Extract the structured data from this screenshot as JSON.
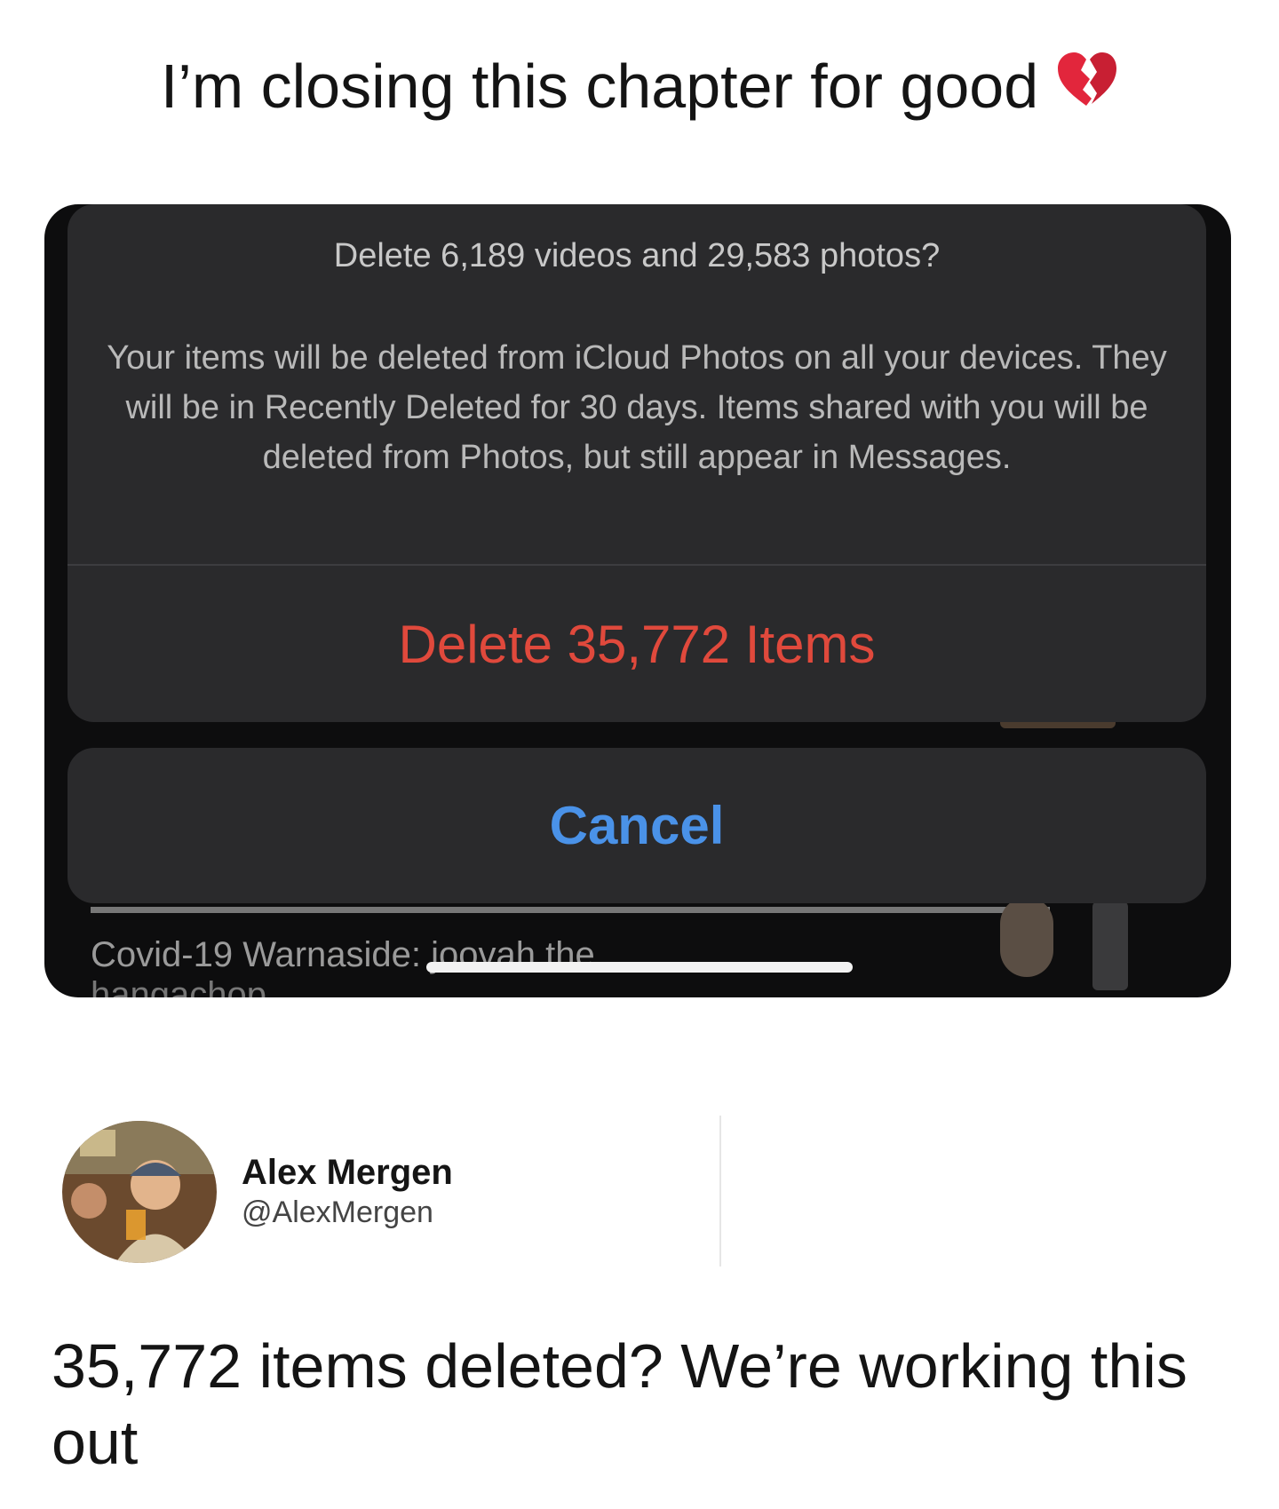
{
  "post": {
    "title_text": "I’m closing this chapter for good",
    "title_emoji": "broken-heart-icon",
    "caption": "35,772 items deleted? We’re working this out"
  },
  "dialog": {
    "title": "Delete 6,189 videos and 29,583 photos?",
    "message": "Your items will be deleted from iCloud Photos on all your devices. They will be in Recently Deleted for 30 days. Items shared with you will be deleted from Photos, but still appear in Messages.",
    "delete_label": "Delete 35,772 Items",
    "cancel_label": "Cancel"
  },
  "background_news": {
    "line_1": "Covid-19 Warnaside: joovah the",
    "line_2": "hangachop"
  },
  "user": {
    "name": "Alex Mergen",
    "handle": "@AlexMergen"
  },
  "colors": {
    "delete": "#e0493c",
    "cancel": "#4a92e8",
    "sheet": "#2a2a2c"
  }
}
